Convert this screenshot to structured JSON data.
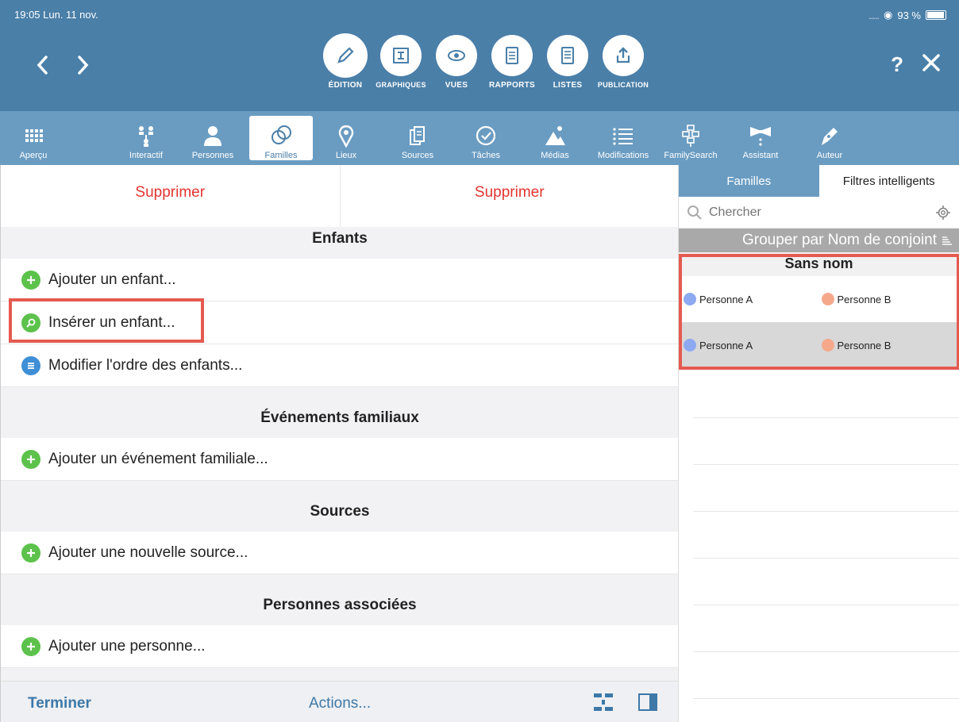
{
  "status": {
    "time": "19:05  Lun. 11 nov.",
    "battery": "93 %"
  },
  "modes": [
    {
      "label": "ÉDITION",
      "icon": "pencil-icon"
    },
    {
      "label": "GRAPHIQUES",
      "icon": "chart-icon"
    },
    {
      "label": "VUES",
      "icon": "eye-icon"
    },
    {
      "label": "RAPPORTS",
      "icon": "report-icon"
    },
    {
      "label": "LISTES",
      "icon": "list-icon"
    },
    {
      "label": "PUBLICATION",
      "icon": "upload-icon"
    }
  ],
  "header": {
    "help": "?"
  },
  "toolbar": [
    {
      "label": "Aperçu",
      "icon": "grid-icon"
    },
    {
      "label": "Interactif",
      "icon": "tree-icon"
    },
    {
      "label": "Personnes",
      "icon": "person-icon"
    },
    {
      "label": "Familles",
      "icon": "rings-icon"
    },
    {
      "label": "Lieux",
      "icon": "pin-icon"
    },
    {
      "label": "Sources",
      "icon": "documents-icon"
    },
    {
      "label": "Tâches",
      "icon": "check-icon"
    },
    {
      "label": "Médias",
      "icon": "media-icon"
    },
    {
      "label": "Modifications",
      "icon": "list-lines-icon"
    },
    {
      "label": "FamilySearch",
      "icon": "familysearch-icon"
    },
    {
      "label": "Assistant",
      "icon": "bowtie-icon"
    },
    {
      "label": "Auteur",
      "icon": "pen-icon"
    }
  ],
  "left": {
    "delete_left": "Supprimer",
    "delete_right": "Supprimer",
    "sections": {
      "enfants": "Enfants",
      "evenements": "Événements familiaux",
      "sources": "Sources",
      "personnes": "Personnes associées"
    },
    "rows": {
      "add_child": "Ajouter un enfant...",
      "insert_child": "Insérer un enfant...",
      "reorder_children": "Modifier l'ordre des enfants...",
      "add_event": "Ajouter un événement familiale...",
      "add_source": "Ajouter une nouvelle source...",
      "add_person": "Ajouter une personne..."
    },
    "bottom": {
      "terminer": "Terminer",
      "actions": "Actions..."
    }
  },
  "right": {
    "tab_familles": "Familles",
    "tab_filtres": "Filtres intelligents",
    "search_placeholder": "Chercher",
    "group_by": "Grouper par Nom de conjoint",
    "group_name": "Sans nom",
    "families": [
      {
        "a": "Personne A",
        "b": "Personne B"
      },
      {
        "a": "Personne A",
        "b": "Personne B"
      }
    ]
  },
  "colors": {
    "header": "#4a7fa8",
    "toolbar": "#6a9cc2",
    "delete": "#e3342f",
    "accent": "#3d78a8",
    "highlight": "#e55a50"
  }
}
